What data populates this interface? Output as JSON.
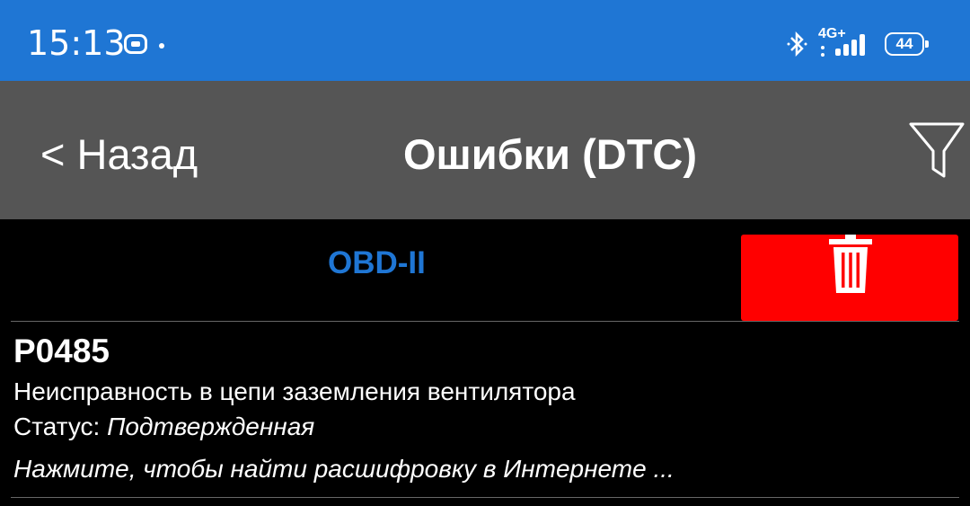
{
  "status_bar": {
    "time": "15:13",
    "network": "4G+",
    "battery": "44",
    "icons": [
      "notification-icon",
      "dot-icon",
      "bluetooth-icon",
      "signal-icon",
      "battery-icon"
    ]
  },
  "app_bar": {
    "back_label": "< Назад",
    "title": "Ошибки (DTC)",
    "filter_icon": "filter-icon"
  },
  "protocol": {
    "label": "OBD-II",
    "color": "#1f76d4"
  },
  "delete_button": {
    "icon": "trash-icon",
    "color": "#ff0000"
  },
  "dtc_list": [
    {
      "code": "P0485",
      "description": "Неисправность в цепи заземления вентилятора",
      "status_label": "Статус:",
      "status_value": "Подтвержденная",
      "hint": "Нажмите, чтобы найти расшифровку в Интернете ..."
    }
  ],
  "colors": {
    "status_bar": "#1f76d4",
    "app_bar": "#555555",
    "background": "#000000"
  }
}
